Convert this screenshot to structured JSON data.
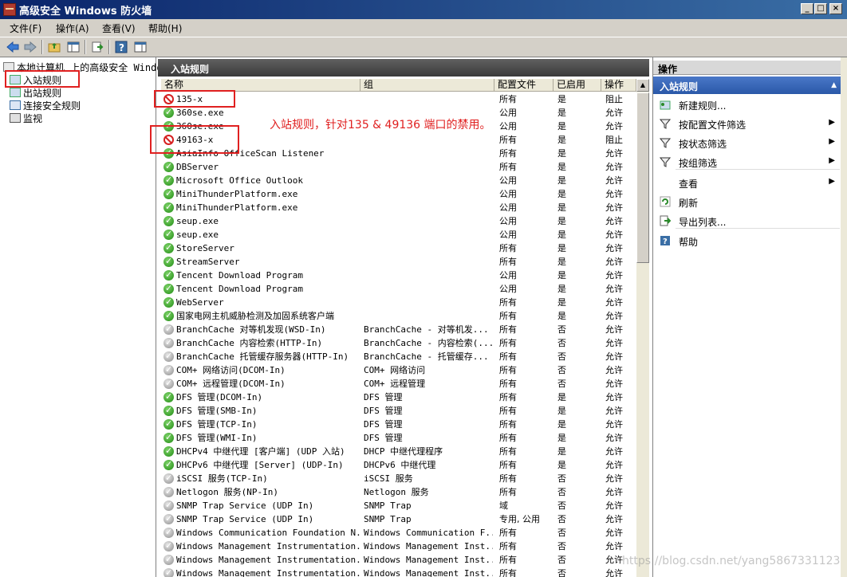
{
  "window": {
    "title": "高级安全 Windows 防火墙"
  },
  "window_buttons": {
    "minimize": "_",
    "maximize": "□",
    "close": "×"
  },
  "menu": [
    "文件(F)",
    "操作(A)",
    "查看(V)",
    "帮助(H)"
  ],
  "tree": {
    "root": "本地计算机 上的高级安全 Windows",
    "items": [
      "入站规则",
      "出站规则",
      "连接安全规则",
      "监视"
    ]
  },
  "center": {
    "header": "入站规则",
    "columns": [
      "名称",
      "组",
      "配置文件",
      "已启用",
      "操作"
    ],
    "rows": [
      {
        "name": "135-x",
        "group": "",
        "profile": "所有",
        "enabled": "是",
        "action": "阻止",
        "icon": "block"
      },
      {
        "name": "360se.exe",
        "group": "",
        "profile": "公用",
        "enabled": "是",
        "action": "允许",
        "icon": "allow"
      },
      {
        "name": "360se.exe",
        "group": "",
        "profile": "公用",
        "enabled": "是",
        "action": "允许",
        "icon": "allow"
      },
      {
        "name": "49163-x",
        "group": "",
        "profile": "所有",
        "enabled": "是",
        "action": "阻止",
        "icon": "block"
      },
      {
        "name": "AsiaInfo OfficeScan Listener",
        "group": "",
        "profile": "所有",
        "enabled": "是",
        "action": "允许",
        "icon": "allow"
      },
      {
        "name": "DBServer",
        "group": "",
        "profile": "所有",
        "enabled": "是",
        "action": "允许",
        "icon": "allow"
      },
      {
        "name": "Microsoft Office Outlook",
        "group": "",
        "profile": "公用",
        "enabled": "是",
        "action": "允许",
        "icon": "allow"
      },
      {
        "name": "MiniThunderPlatform.exe",
        "group": "",
        "profile": "公用",
        "enabled": "是",
        "action": "允许",
        "icon": "allow"
      },
      {
        "name": "MiniThunderPlatform.exe",
        "group": "",
        "profile": "公用",
        "enabled": "是",
        "action": "允许",
        "icon": "allow"
      },
      {
        "name": "seup.exe",
        "group": "",
        "profile": "公用",
        "enabled": "是",
        "action": "允许",
        "icon": "allow"
      },
      {
        "name": "seup.exe",
        "group": "",
        "profile": "公用",
        "enabled": "是",
        "action": "允许",
        "icon": "allow"
      },
      {
        "name": "StoreServer",
        "group": "",
        "profile": "所有",
        "enabled": "是",
        "action": "允许",
        "icon": "allow"
      },
      {
        "name": "StreamServer",
        "group": "",
        "profile": "所有",
        "enabled": "是",
        "action": "允许",
        "icon": "allow"
      },
      {
        "name": "Tencent Download Program",
        "group": "",
        "profile": "公用",
        "enabled": "是",
        "action": "允许",
        "icon": "allow"
      },
      {
        "name": "Tencent Download Program",
        "group": "",
        "profile": "公用",
        "enabled": "是",
        "action": "允许",
        "icon": "allow"
      },
      {
        "name": "WebServer",
        "group": "",
        "profile": "所有",
        "enabled": "是",
        "action": "允许",
        "icon": "allow"
      },
      {
        "name": "国家电网主机威胁检测及加固系统客户端",
        "group": "",
        "profile": "所有",
        "enabled": "是",
        "action": "允许",
        "icon": "allow"
      },
      {
        "name": "BranchCache 对等机发现(WSD-In)",
        "group": "BranchCache - 对等机发...",
        "profile": "所有",
        "enabled": "否",
        "action": "允许",
        "icon": "disabled"
      },
      {
        "name": "BranchCache 内容检索(HTTP-In)",
        "group": "BranchCache - 内容检索(...",
        "profile": "所有",
        "enabled": "否",
        "action": "允许",
        "icon": "disabled"
      },
      {
        "name": "BranchCache 托管缓存服务器(HTTP-In)",
        "group": "BranchCache - 托管缓存...",
        "profile": "所有",
        "enabled": "否",
        "action": "允许",
        "icon": "disabled"
      },
      {
        "name": "COM+ 网络访问(DCOM-In)",
        "group": "COM+ 网络访问",
        "profile": "所有",
        "enabled": "否",
        "action": "允许",
        "icon": "disabled"
      },
      {
        "name": "COM+ 远程管理(DCOM-In)",
        "group": "COM+ 远程管理",
        "profile": "所有",
        "enabled": "否",
        "action": "允许",
        "icon": "disabled"
      },
      {
        "name": "DFS 管理(DCOM-In)",
        "group": "DFS 管理",
        "profile": "所有",
        "enabled": "是",
        "action": "允许",
        "icon": "allow"
      },
      {
        "name": "DFS 管理(SMB-In)",
        "group": "DFS 管理",
        "profile": "所有",
        "enabled": "是",
        "action": "允许",
        "icon": "allow"
      },
      {
        "name": "DFS 管理(TCP-In)",
        "group": "DFS 管理",
        "profile": "所有",
        "enabled": "是",
        "action": "允许",
        "icon": "allow"
      },
      {
        "name": "DFS 管理(WMI-In)",
        "group": "DFS 管理",
        "profile": "所有",
        "enabled": "是",
        "action": "允许",
        "icon": "allow"
      },
      {
        "name": "DHCPv4 中继代理 [客户端] (UDP 入站)",
        "group": "DHCP 中继代理程序",
        "profile": "所有",
        "enabled": "是",
        "action": "允许",
        "icon": "allow"
      },
      {
        "name": "DHCPv6 中继代理 [Server] (UDP-In)",
        "group": "DHCPv6 中继代理",
        "profile": "所有",
        "enabled": "是",
        "action": "允许",
        "icon": "allow"
      },
      {
        "name": "iSCSI 服务(TCP-In)",
        "group": "iSCSI 服务",
        "profile": "所有",
        "enabled": "否",
        "action": "允许",
        "icon": "disabled"
      },
      {
        "name": "Netlogon 服务(NP-In)",
        "group": "Netlogon 服务",
        "profile": "所有",
        "enabled": "否",
        "action": "允许",
        "icon": "disabled"
      },
      {
        "name": "SNMP Trap Service (UDP In)",
        "group": "SNMP Trap",
        "profile": "域",
        "enabled": "否",
        "action": "允许",
        "icon": "disabled"
      },
      {
        "name": "SNMP Trap Service (UDP In)",
        "group": "SNMP Trap",
        "profile": "专用, 公用",
        "enabled": "否",
        "action": "允许",
        "icon": "disabled"
      },
      {
        "name": "Windows Communication Foundation N...",
        "group": "Windows Communication F...",
        "profile": "所有",
        "enabled": "否",
        "action": "允许",
        "icon": "disabled"
      },
      {
        "name": "Windows Management Instrumentation...",
        "group": "Windows Management Inst...",
        "profile": "所有",
        "enabled": "否",
        "action": "允许",
        "icon": "disabled"
      },
      {
        "name": "Windows Management Instrumentation...",
        "group": "Windows Management Inst...",
        "profile": "所有",
        "enabled": "否",
        "action": "允许",
        "icon": "disabled"
      },
      {
        "name": "Windows Management Instrumentation...",
        "group": "Windows Management Inst...",
        "profile": "所有",
        "enabled": "否",
        "action": "允许",
        "icon": "disabled"
      }
    ]
  },
  "annotation": "入站规则，针对135 & 49136 端口的禁用。",
  "actions": {
    "header": "操作",
    "section": "入站规则",
    "items": [
      {
        "label": "新建规则...",
        "icon": "new-rule-icon",
        "arrow": ""
      },
      {
        "label": "按配置文件筛选",
        "icon": "filter-icon",
        "arrow": "▶"
      },
      {
        "label": "按状态筛选",
        "icon": "filter-icon",
        "arrow": "▶"
      },
      {
        "label": "按组筛选",
        "icon": "filter-icon",
        "arrow": "▶"
      },
      {
        "label": "查看",
        "icon": "",
        "arrow": "▶"
      },
      {
        "label": "刷新",
        "icon": "refresh-icon",
        "arrow": ""
      },
      {
        "label": "导出列表...",
        "icon": "export-icon",
        "arrow": ""
      },
      {
        "label": "帮助",
        "icon": "help-icon",
        "arrow": ""
      }
    ]
  },
  "watermark": "https://blog.csdn.net/yang5867331123",
  "colors": {
    "accent_red": "#e02020",
    "section_blue": "#2a58a8",
    "allow_green": "#1f8a12"
  }
}
